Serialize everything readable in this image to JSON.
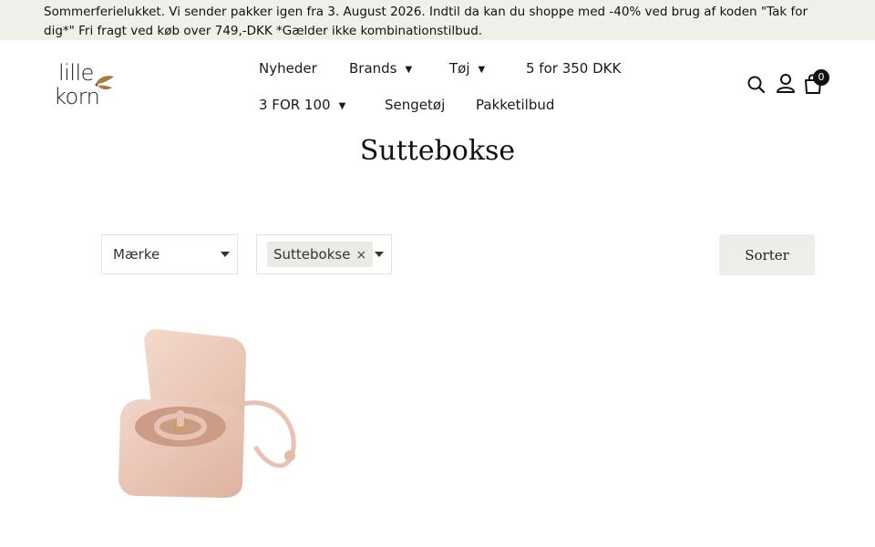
{
  "announcement": {
    "text": "Sommerferielukket. Vi sender pakker igen fra 3. August 2026. Indtil da kan du shoppe med -40% ved brug af koden \"Tak for dig*\" Fri fragt ved køb over 749,-DKK *Gælder ikke kombinationstilbud."
  },
  "brand": {
    "logo_line1": "lille",
    "logo_line2": "korn",
    "leaf_color": "#a9793f"
  },
  "nav": {
    "items": [
      {
        "label": "Nyheder",
        "has_dropdown": false
      },
      {
        "label": "Brands",
        "has_dropdown": true
      },
      {
        "label": "Tøj",
        "has_dropdown": true
      },
      {
        "label": "5 for 350 DKK",
        "has_dropdown": false
      },
      {
        "label": "3 FOR 100",
        "has_dropdown": true
      },
      {
        "label": "Sengetøj",
        "has_dropdown": false
      },
      {
        "label": "Pakketilbud",
        "has_dropdown": false
      }
    ],
    "caret": "▼"
  },
  "header_icons": {
    "search": "search-icon",
    "account": "user-icon",
    "cart": "shopping-bag-icon",
    "cart_count": "0"
  },
  "page": {
    "title": "Suttebokse"
  },
  "filters": {
    "brand_placeholder": "Mærke",
    "category_selected": "Suttebokse",
    "remove_symbol": "×",
    "sort_label": "Sorter"
  },
  "products": [
    {
      "image": "pacifier-box-pink-image",
      "color": "#e8c3b3"
    }
  ]
}
